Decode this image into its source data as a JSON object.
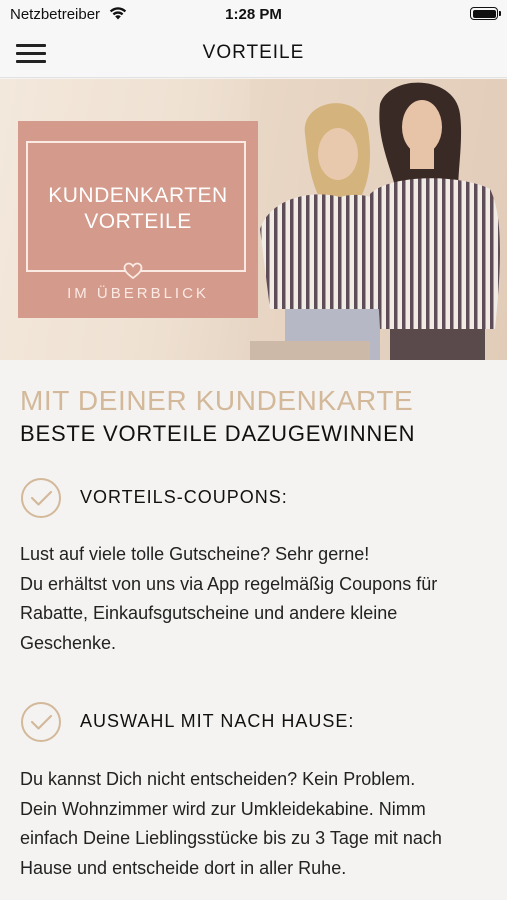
{
  "status_bar": {
    "carrier": "Netzbetreiber",
    "time": "1:28 PM",
    "battery_level": 1.0
  },
  "nav": {
    "title": "VORTEILE",
    "menu_icon": "hamburger-icon"
  },
  "hero": {
    "title_line1": "KUNDENKARTEN",
    "title_line2": "VORTEILE",
    "subtitle": "IM ÜBERBLICK",
    "icon": "heart-icon",
    "box_color": "#d49a8b"
  },
  "headline": {
    "line1": "MIT DEINER KUNDENKARTE",
    "line2": "BESTE VORTEILE DAZUGEWINNEN",
    "accent_color": "#d3b99a"
  },
  "benefits": [
    {
      "icon": "check-circle-icon",
      "title": "VORTEILS-COUPONS:",
      "lines": [
        "Lust auf viele tolle Gutscheine? Sehr gerne!",
        "Du erhältst von uns via App regelmäßig Coupons für",
        "Rabatte, Einkaufsgutscheine und andere kleine",
        "Geschenke."
      ]
    },
    {
      "icon": "check-circle-icon",
      "title": "AUSWAHL MIT NACH HAUSE:",
      "lines": [
        "Du kannst Dich nicht entscheiden? Kein Problem.",
        "Dein Wohnzimmer wird zur Umkleidekabine. Nimm",
        "einfach Deine Lieblingsstücke bis zu 3 Tage mit nach",
        "Hause und entscheide dort in aller Ruhe."
      ]
    }
  ]
}
